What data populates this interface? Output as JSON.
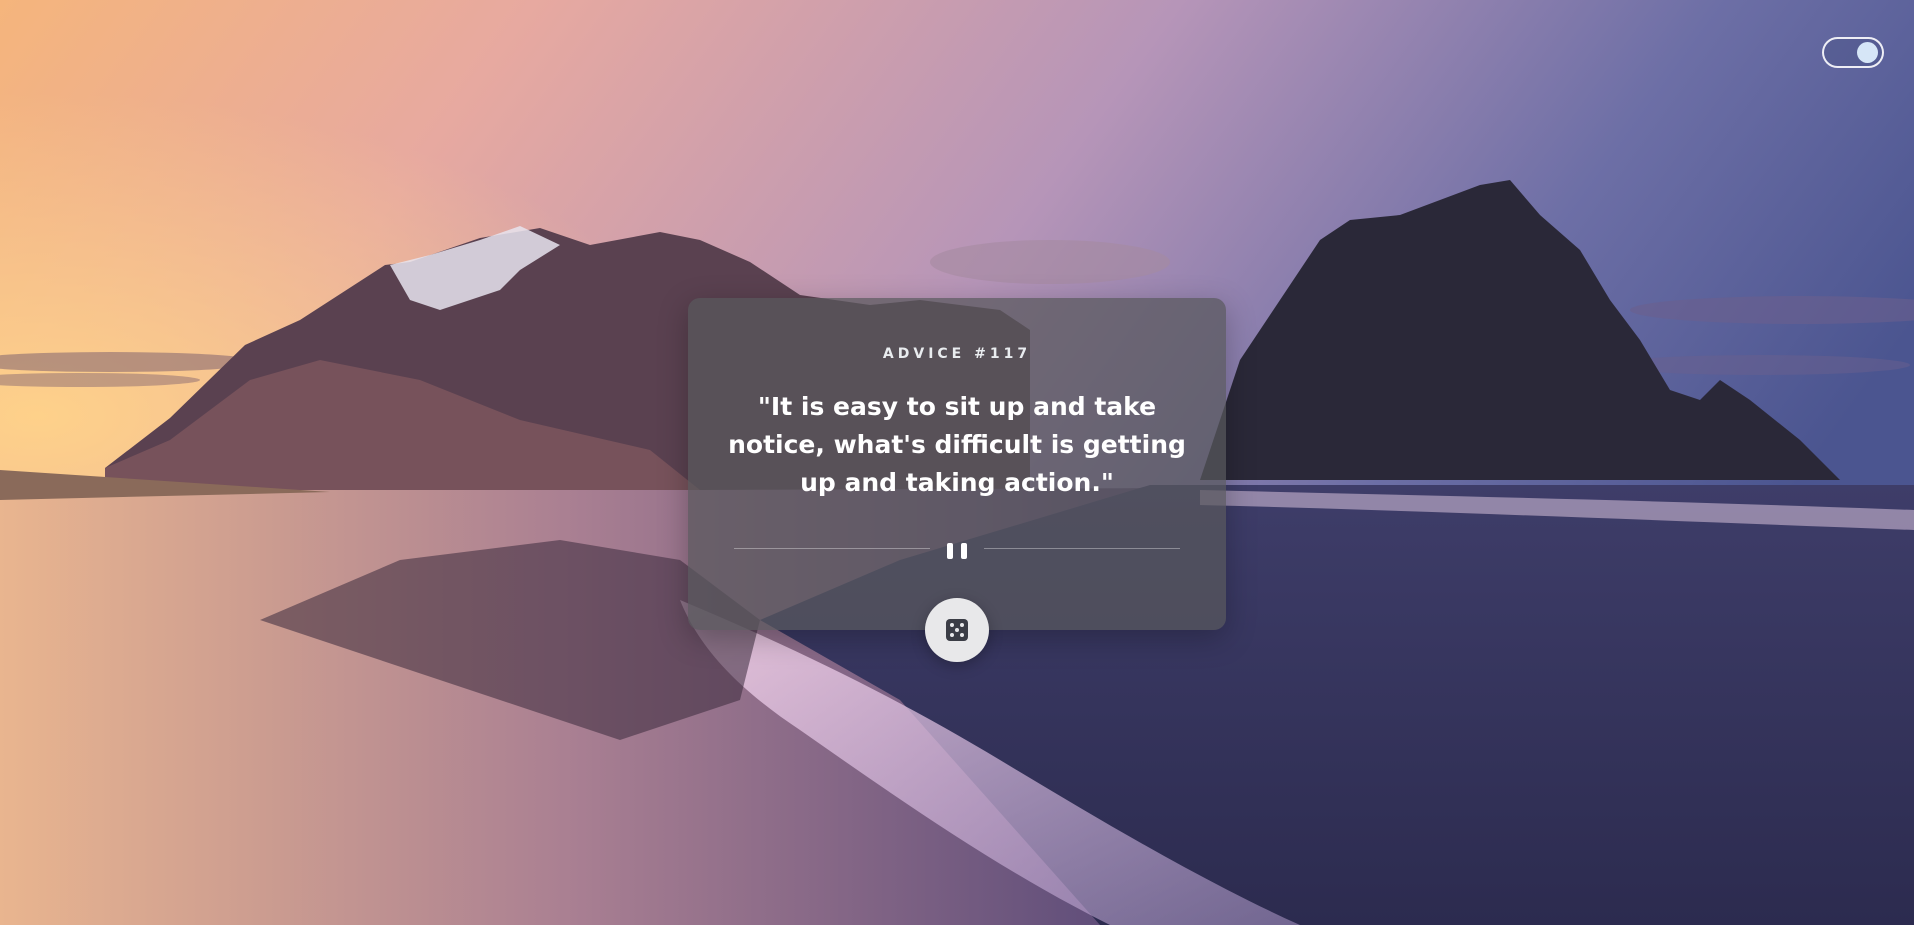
{
  "background": {
    "scene": "mountains-beach-sunset"
  },
  "theme_toggle": {
    "state": "on"
  },
  "advice": {
    "heading": "ADVICE #117",
    "text": "\"It is easy to sit up and take notice, what's difficult is getting up and taking action.\""
  },
  "icons": {
    "divider": "pause-icon",
    "dice": "dice-icon"
  },
  "colors": {
    "card": "#58585c",
    "button": "#e8e8ea",
    "text": "#ffffff"
  }
}
